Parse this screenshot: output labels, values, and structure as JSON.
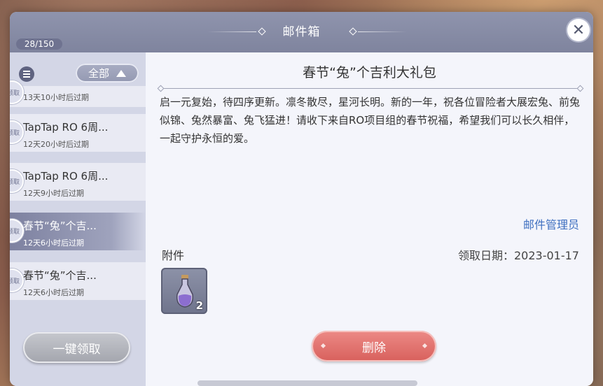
{
  "window": {
    "title": "邮件箱",
    "mail_count": "28/150"
  },
  "sidebar": {
    "filter_label": "全部",
    "claim_all_label": "一键领取",
    "items": [
      {
        "subject": "",
        "expire": "13天10小时后过期",
        "avatar": "领取"
      },
      {
        "subject": "TapTap RO 6周...",
        "expire": "12天20小时后过期",
        "avatar": "领取"
      },
      {
        "subject": "TapTap RO 6周...",
        "expire": "12天9小时后过期",
        "avatar": "领取"
      },
      {
        "subject": "春节“兔”个吉...",
        "expire": "12天6小时后过期",
        "avatar": "领取"
      },
      {
        "subject": "春节“兔”个吉...",
        "expire": "12天6小时后过期",
        "avatar": "领取"
      }
    ]
  },
  "mail": {
    "title": "春节“兔”个吉利大礼包",
    "body": "启一元复始，待四序更新。凛冬散尽，星河长明。新的一年，祝各位冒险者大展宏兔、前兔似锦、兔然暴富、兔飞猛进！请收下来自RO项目组的春节祝福，希望我们可以长久相伴，一起守护永恒的爱。",
    "sender": "邮件管理员",
    "attachments_label": "附件",
    "claim_date": "领取日期：2023-01-17",
    "attachments": [
      {
        "icon": "potion-bottle-icon",
        "quantity": "2"
      }
    ],
    "delete_label": "删除"
  },
  "colors": {
    "selected": "#7d81a0",
    "delete": "#d8605c",
    "sender_link": "#3e6fc0"
  }
}
